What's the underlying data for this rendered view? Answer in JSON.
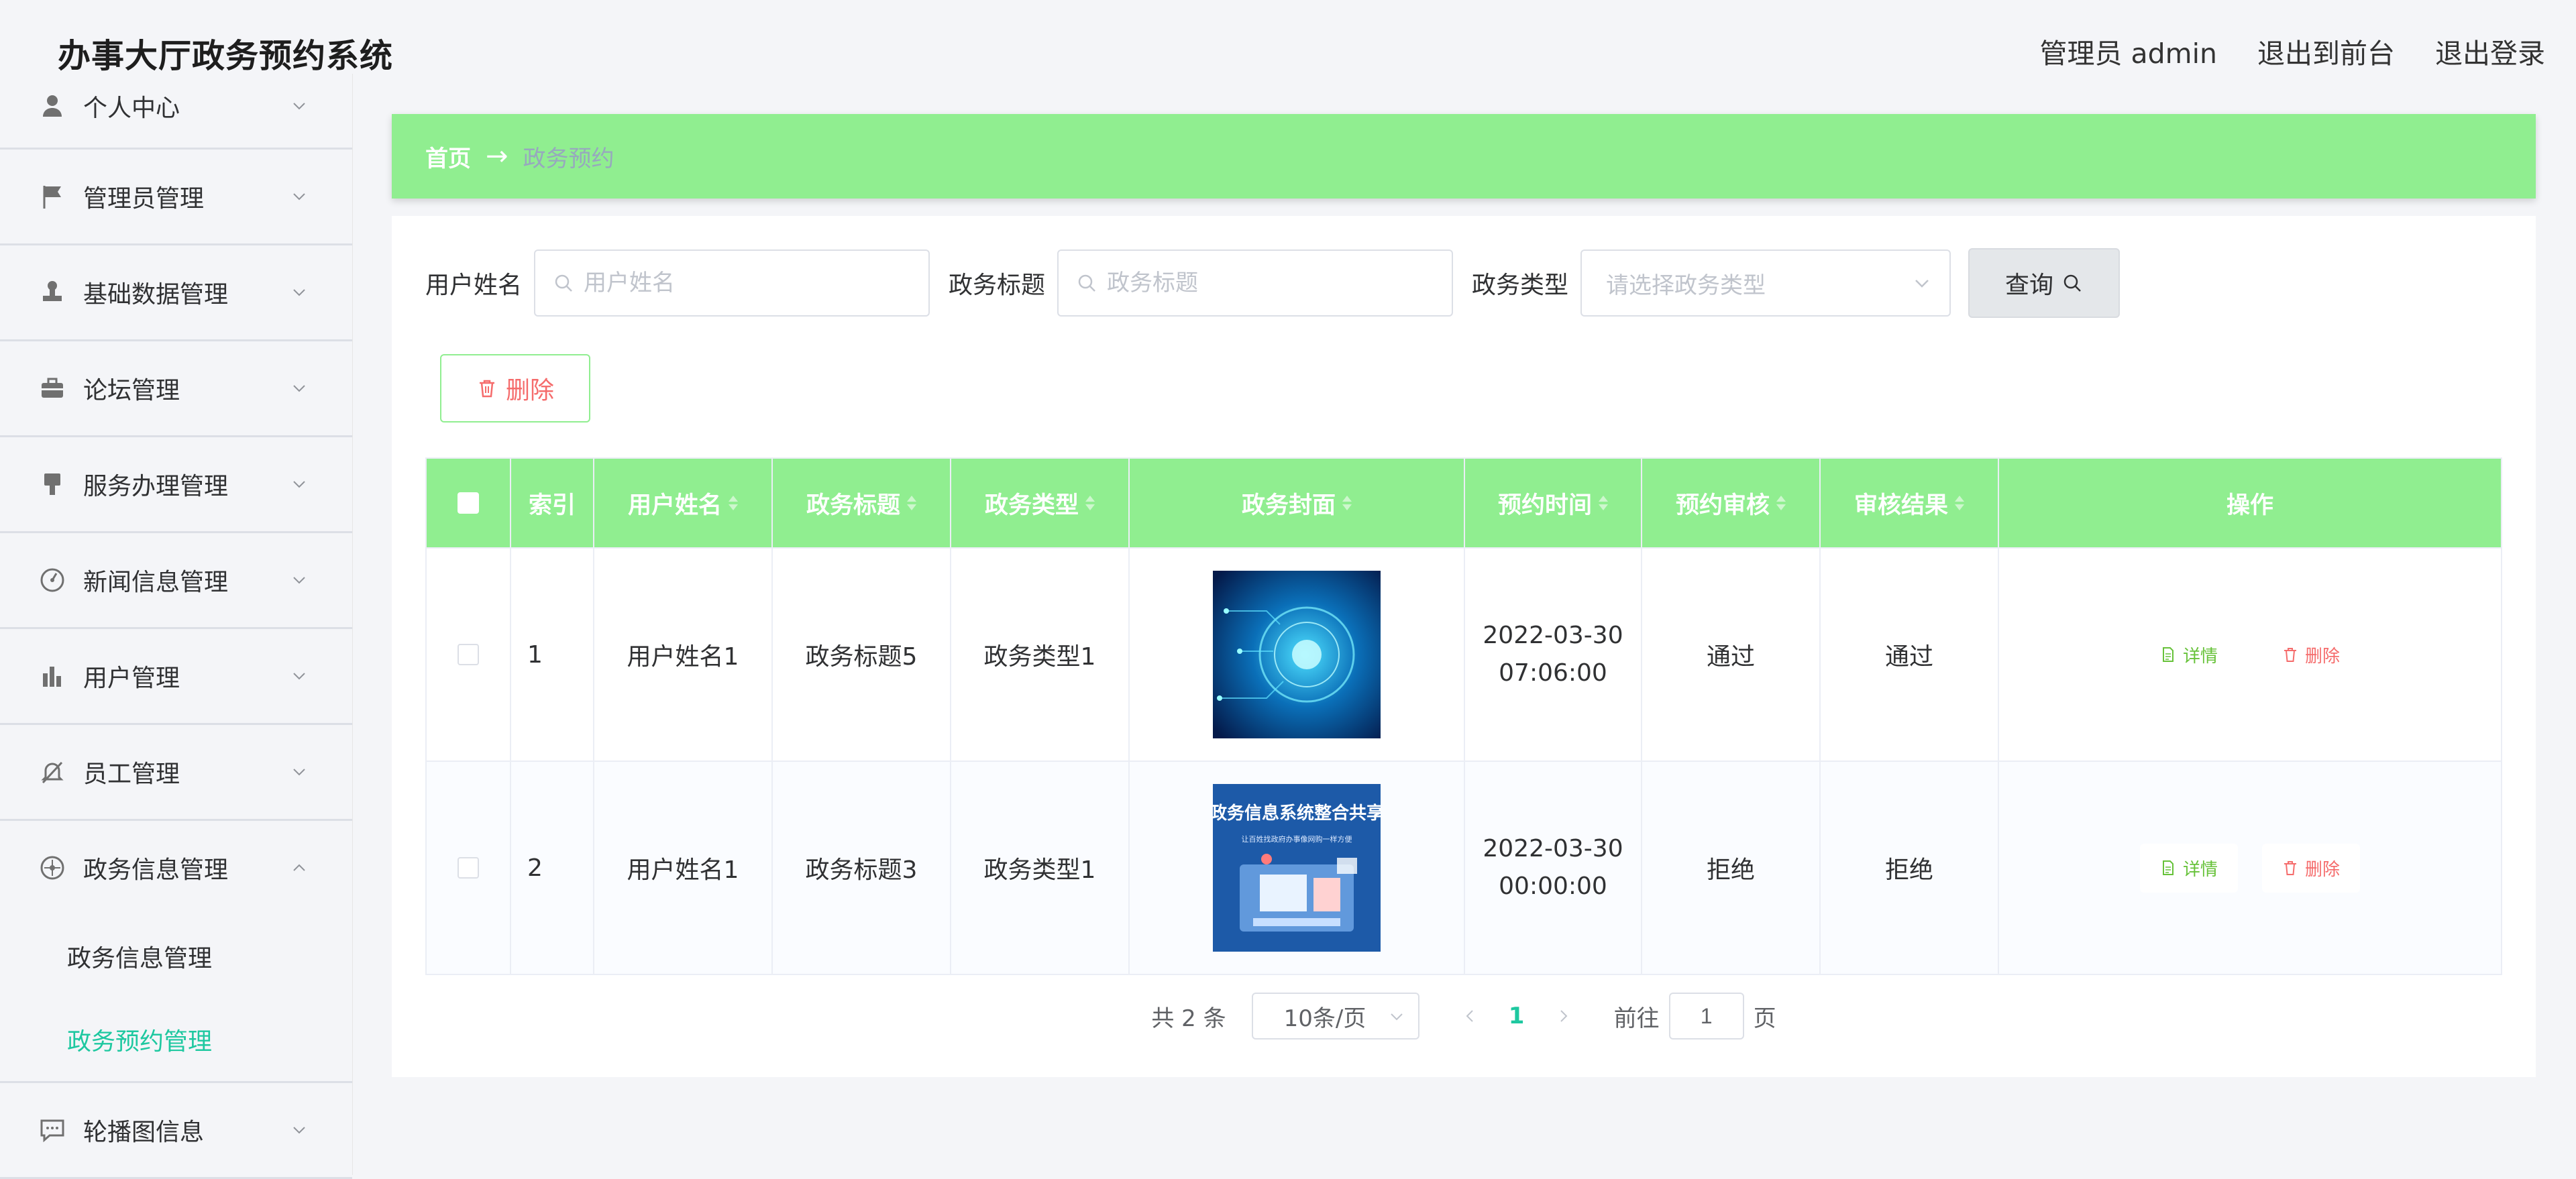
{
  "header": {
    "title": "办事大厅政务预约系统",
    "user": "管理员 admin",
    "to_front": "退出到前台",
    "logout": "退出登录"
  },
  "sidebar": {
    "items": [
      {
        "label": "个人中心",
        "icon": "user-icon"
      },
      {
        "label": "管理员管理",
        "icon": "flag-icon"
      },
      {
        "label": "基础数据管理",
        "icon": "stamp-icon"
      },
      {
        "label": "论坛管理",
        "icon": "briefcase-icon"
      },
      {
        "label": "服务办理管理",
        "icon": "brush-icon"
      },
      {
        "label": "新闻信息管理",
        "icon": "dashboard-icon"
      },
      {
        "label": "用户管理",
        "icon": "bar-chart-icon"
      },
      {
        "label": "员工管理",
        "icon": "bell-off-icon"
      }
    ],
    "open_group": {
      "label": "政务信息管理",
      "icon": "compass-icon",
      "sub_items": [
        {
          "label": "政务信息管理",
          "active": false
        },
        {
          "label": "政务预约管理",
          "active": true
        }
      ]
    },
    "last_item": {
      "label": "轮播图信息",
      "icon": "chat-icon"
    }
  },
  "breadcrumb": {
    "home": "首页",
    "separator": "→",
    "current": "政务预约"
  },
  "filters": {
    "username_label": "用户姓名",
    "username_placeholder": "用户姓名",
    "title_label": "政务标题",
    "title_placeholder": "政务标题",
    "type_label": "政务类型",
    "type_placeholder": "请选择政务类型",
    "query_button": "查询"
  },
  "actions": {
    "delete_button": "删除"
  },
  "table": {
    "columns": [
      "索引",
      "用户姓名",
      "政务标题",
      "政务类型",
      "政务封面",
      "预约时间",
      "预约审核",
      "审核结果",
      "操作"
    ],
    "rows": [
      {
        "index": "1",
        "username": "用户姓名1",
        "title": "政务标题5",
        "type": "政务类型1",
        "date": "2022-03-30",
        "time": "07:06:00",
        "review": "通过",
        "result": "通过",
        "cover_caption": "",
        "cover_subcaption": ""
      },
      {
        "index": "2",
        "username": "用户姓名1",
        "title": "政务标题3",
        "type": "政务类型1",
        "date": "2022-03-30",
        "time": "00:00:00",
        "review": "拒绝",
        "result": "拒绝",
        "cover_caption": "政务信息系统整合共享",
        "cover_subcaption": "让百姓找政府办事像网购一样方便"
      }
    ],
    "detail_label": "详情",
    "delete_label": "删除"
  },
  "pagination": {
    "total": "共 2 条",
    "page_size": "10条/页",
    "current_page": "1",
    "goto_label": "前往",
    "goto_value": "1",
    "page_unit": "页"
  },
  "colors": {
    "accent_green": "#90ee90",
    "active_teal": "#1ec8a0",
    "danger": "#f56c6c",
    "success": "#67c23a"
  }
}
